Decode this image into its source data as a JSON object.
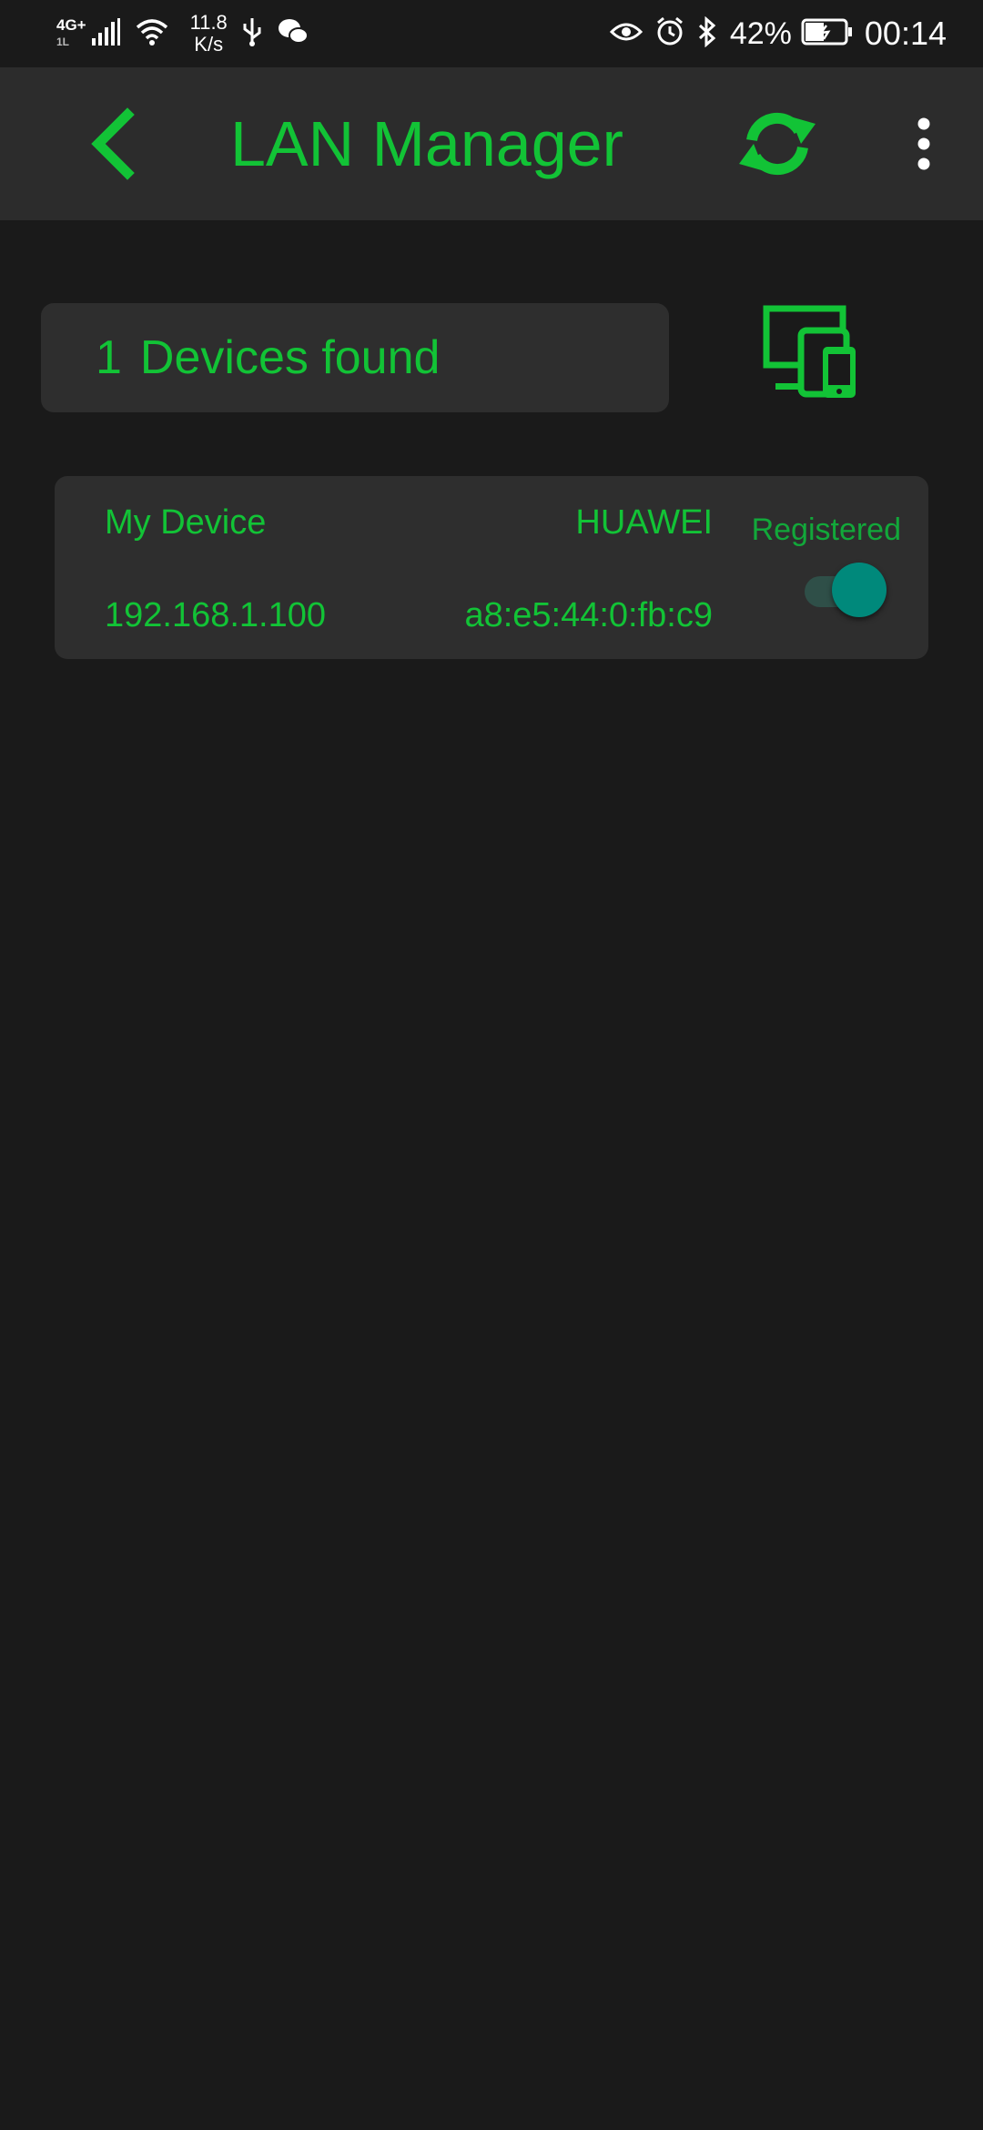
{
  "status_bar": {
    "network_type": "4G+",
    "network_sub": "1L",
    "speed_value": "11.8",
    "speed_unit": "K/s",
    "battery": "42%",
    "time": "00:14",
    "icons": [
      "signal-icon",
      "wifi-icon",
      "usb-icon",
      "wechat-icon",
      "eye-icon",
      "alarm-icon",
      "bluetooth-icon",
      "battery-icon"
    ]
  },
  "app_bar": {
    "title": "LAN Manager",
    "icons": [
      "back-arrow-icon",
      "refresh-icon",
      "more-vertical-icon"
    ]
  },
  "summary": {
    "count": "1",
    "label": "Devices found",
    "icon": "devices-icon"
  },
  "devices": [
    {
      "name": "My Device",
      "vendor": "HUAWEI",
      "ip": "192.168.1.100",
      "mac": "a8:e5:44:0:fb:c9",
      "status": "Registered",
      "registered": true
    }
  ],
  "colors": {
    "accent": "#12c336",
    "background": "#1a1a1a",
    "app_bar": "#2c2c2c",
    "card": "#2e2e2e",
    "toggle_thumb": "#00897b",
    "toggle_track": "#2f4f48"
  }
}
